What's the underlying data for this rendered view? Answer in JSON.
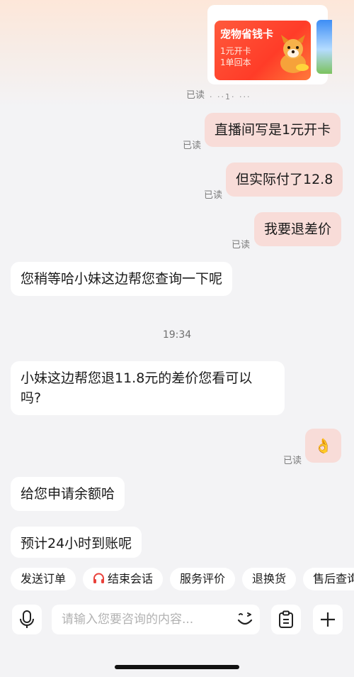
{
  "promo_card": {
    "title": "宠物省钱卡",
    "line1": "1元开卡",
    "line2": "1单回本",
    "peek_text": "·  ··1·    ···"
  },
  "messages": [
    {
      "side": "out",
      "text": "直播间写是1元开卡",
      "status": "已读"
    },
    {
      "side": "out",
      "text": "但实际付了12.8",
      "status": "已读"
    },
    {
      "side": "out",
      "text": "我要退差价",
      "status": "已读"
    },
    {
      "side": "in",
      "text": "您稍等哈小妹这边帮您查询一下呢"
    },
    {
      "side": "in",
      "line1": "小妹这边帮您退11.8元的差价您看可以",
      "line2": "吗?"
    },
    {
      "side": "out",
      "text": "👌",
      "status": "已读"
    },
    {
      "side": "in",
      "text": "给您申请余额哈"
    },
    {
      "side": "in",
      "text": "预计24小时到账呢"
    }
  ],
  "card_status": "已读",
  "timestamp": "19:34",
  "quick_actions": [
    "发送订单",
    "结束会话",
    "服务评价",
    "退换货",
    "售后查询"
  ],
  "input": {
    "placeholder": "请输入您要咨询的内容..."
  },
  "icons": {
    "mic": "microphone-icon",
    "emoji": "emoji-wink-icon",
    "clipboard": "clipboard-icon",
    "plus": "plus-icon",
    "headset": "headset-icon"
  },
  "colors": {
    "outgoing_bubble": "#f8dcd8",
    "incoming_bubble": "#ffffff",
    "background": "#f3f3f5",
    "promo_red": "#ff3c28"
  }
}
